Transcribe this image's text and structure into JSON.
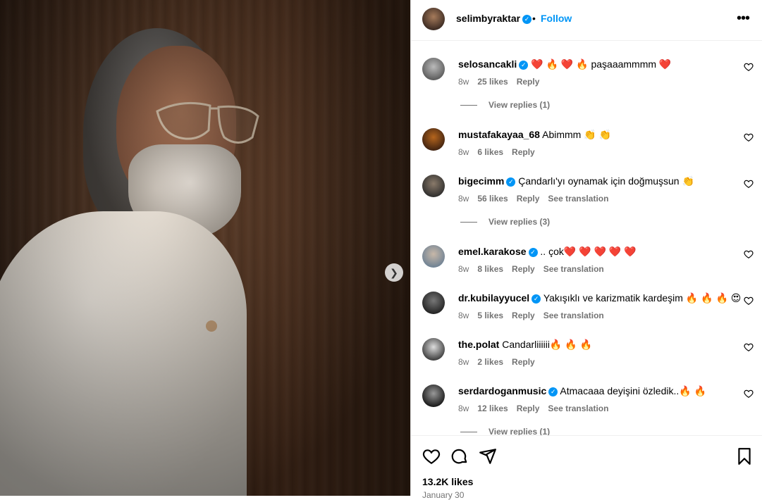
{
  "post": {
    "author": "selimbyraktar",
    "follow_label": "Follow",
    "separator": "•",
    "likes": "13.2K likes",
    "date": "January 30"
  },
  "comments": [
    {
      "user": "selosancakli",
      "verified": true,
      "text": "❤️ 🔥 ❤️ 🔥 paşaaammmm ❤️",
      "time": "8w",
      "likes": "25 likes",
      "reply": "Reply",
      "translate": "",
      "replies": "View replies (1)"
    },
    {
      "user": "mustafakayaa_68",
      "verified": false,
      "text": "Abimmm 👏 👏",
      "time": "8w",
      "likes": "6 likes",
      "reply": "Reply",
      "translate": "",
      "replies": ""
    },
    {
      "user": "bigecimm",
      "verified": true,
      "text": "Çandarlı'yı oynamak için doğmuşsun 👏",
      "time": "8w",
      "likes": "56 likes",
      "reply": "Reply",
      "translate": "See translation",
      "replies": "View replies (3)"
    },
    {
      "user": "emel.karakose",
      "verified": true,
      "text": ".. çok❤️ ❤️ ❤️ ❤️ ❤️",
      "time": "8w",
      "likes": "8 likes",
      "reply": "Reply",
      "translate": "See translation",
      "replies": ""
    },
    {
      "user": "dr.kubilayyucel",
      "verified": true,
      "text": "Yakışıklı ve karizmatik kardeşim 🔥 🔥 🔥 😍",
      "time": "8w",
      "likes": "5 likes",
      "reply": "Reply",
      "translate": "See translation",
      "replies": ""
    },
    {
      "user": "the.polat",
      "verified": false,
      "text": "Candarliiiiii🔥 🔥 🔥",
      "time": "8w",
      "likes": "2 likes",
      "reply": "Reply",
      "translate": "",
      "replies": ""
    },
    {
      "user": "serdardoganmusic",
      "verified": true,
      "text": "Atmacaaa deyişini özledik..🔥 🔥",
      "time": "8w",
      "likes": "12 likes",
      "reply": "Reply",
      "translate": "See translation",
      "replies": "View replies (1)"
    }
  ],
  "icons": [
    "more-icon",
    "heart-icon",
    "comment-icon",
    "share-icon",
    "bookmark-icon",
    "chevron-right-icon",
    "verified-icon"
  ],
  "colors": {
    "accent": "#0095f6",
    "muted": "#737373",
    "text": "#000000"
  }
}
